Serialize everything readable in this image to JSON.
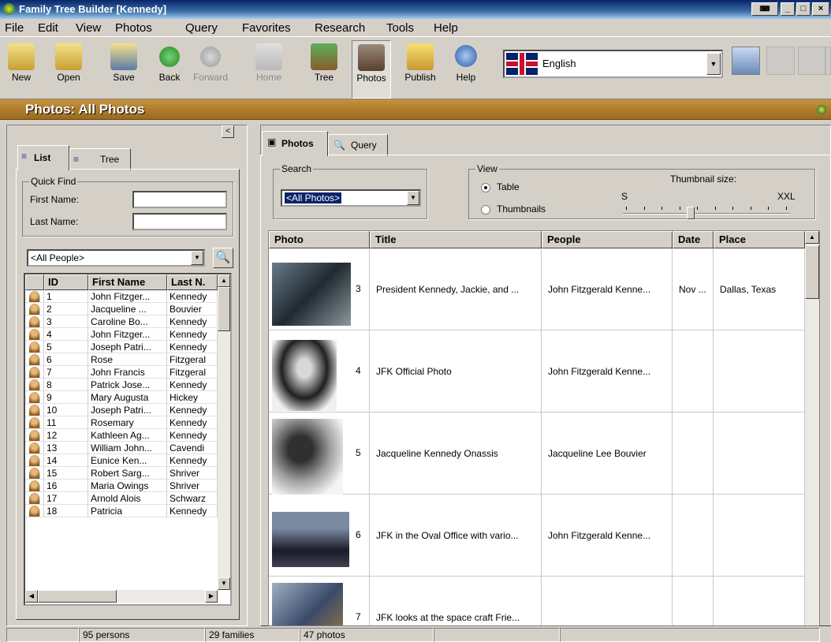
{
  "window": {
    "title": "Family Tree Builder [Kennedy]"
  },
  "menu": [
    "File",
    "Edit",
    "View",
    "Photos",
    "Query",
    "Favorites",
    "Research",
    "Tools",
    "Help"
  ],
  "toolbar": {
    "buttons": [
      {
        "label": "New",
        "enabled": true
      },
      {
        "label": "Open",
        "enabled": true
      },
      {
        "label": "Save",
        "enabled": true
      },
      {
        "label": "Back",
        "enabled": true
      },
      {
        "label": "Forward",
        "enabled": false
      },
      {
        "label": "Home",
        "enabled": false
      },
      {
        "label": "Tree",
        "enabled": true
      },
      {
        "label": "Photos",
        "enabled": true,
        "pressed": true
      },
      {
        "label": "Publish",
        "enabled": true
      },
      {
        "label": "Help",
        "enabled": true
      }
    ],
    "language": "English"
  },
  "section_title": "Photos: All Photos",
  "left": {
    "tabs": [
      "List",
      "Tree"
    ],
    "quick_find": {
      "caption": "Quick Find",
      "first_name_label": "First Name:",
      "last_name_label": "Last Name:",
      "first_name_value": "",
      "last_name_value": ""
    },
    "filter": "<All People>",
    "columns": [
      "ID",
      "First Name",
      "Last N."
    ],
    "people": [
      {
        "id": "1",
        "first": "John Fitzger...",
        "last": "Kennedy"
      },
      {
        "id": "2",
        "first": "Jacqueline ...",
        "last": "Bouvier"
      },
      {
        "id": "3",
        "first": "Caroline Bo...",
        "last": "Kennedy"
      },
      {
        "id": "4",
        "first": "John Fitzger...",
        "last": "Kennedy"
      },
      {
        "id": "5",
        "first": "Joseph Patri...",
        "last": "Kennedy"
      },
      {
        "id": "6",
        "first": "Rose",
        "last": "Fitzgeral"
      },
      {
        "id": "7",
        "first": "John Francis",
        "last": "Fitzgeral"
      },
      {
        "id": "8",
        "first": "Patrick Jose...",
        "last": "Kennedy"
      },
      {
        "id": "9",
        "first": "Mary Augusta",
        "last": "Hickey"
      },
      {
        "id": "10",
        "first": "Joseph Patri...",
        "last": "Kennedy"
      },
      {
        "id": "11",
        "first": "Rosemary",
        "last": "Kennedy"
      },
      {
        "id": "12",
        "first": "Kathleen Ag...",
        "last": "Kennedy"
      },
      {
        "id": "13",
        "first": "William John...",
        "last": "Cavendi"
      },
      {
        "id": "14",
        "first": "Eunice Ken...",
        "last": "Kennedy"
      },
      {
        "id": "15",
        "first": "Robert Sarg...",
        "last": "Shriver"
      },
      {
        "id": "16",
        "first": "Maria Owings",
        "last": "Shriver"
      },
      {
        "id": "17",
        "first": "Arnold Alois",
        "last": "Schwarz"
      },
      {
        "id": "18",
        "first": "Patricia",
        "last": "Kennedy"
      }
    ]
  },
  "right": {
    "tabs": [
      "Photos",
      "Query"
    ],
    "search": {
      "caption": "Search",
      "value": "<All Photos>"
    },
    "view": {
      "caption": "View",
      "table_label": "Table",
      "thumbnails_label": "Thumbnails",
      "selected": "Table"
    },
    "thumbnail_size": {
      "label": "Thumbnail size:",
      "min_label": "S",
      "max_label": "XXL",
      "level": 0.4
    },
    "columns": [
      "Photo",
      "Title",
      "People",
      "Date",
      "Place"
    ],
    "photos": [
      {
        "num": "3",
        "title": "President Kennedy, Jackie, and ...",
        "people": "John Fitzgerald Kenne...",
        "date": "Nov ...",
        "place": "Dallas, Texas"
      },
      {
        "num": "4",
        "title": "JFK Official Photo",
        "people": "John Fitzgerald Kenne...",
        "date": "",
        "place": ""
      },
      {
        "num": "5",
        "title": "Jacqueline Kennedy Onassis",
        "people": "Jacqueline Lee Bouvier",
        "date": "",
        "place": ""
      },
      {
        "num": "6",
        "title": "JFK in the Oval Office with vario...",
        "people": "John Fitzgerald Kenne...",
        "date": "",
        "place": ""
      },
      {
        "num": "7",
        "title": "JFK looks at the space craft Frie...",
        "people": "",
        "date": "",
        "place": ""
      }
    ]
  },
  "status": {
    "persons": "95 persons",
    "families": "29 families",
    "photos": "47 photos"
  }
}
